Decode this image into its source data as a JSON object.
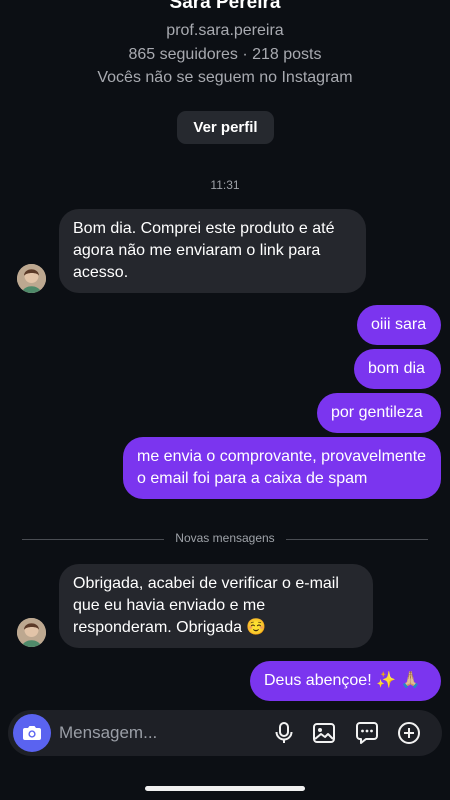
{
  "profile": {
    "name": "Sara Pereira",
    "handle": "prof.sara.pereira",
    "stats": "865 seguidores · 218 posts",
    "follow_note": "Vocês não se seguem no Instagram",
    "view_profile_label": "Ver perfil"
  },
  "chat": {
    "timestamp": "11:31",
    "messages": [
      {
        "from": "them",
        "text": "Bom dia. Comprei este produto e até agora não me enviaram o link para acesso."
      },
      {
        "from": "me",
        "text": "oiii sara"
      },
      {
        "from": "me",
        "text": "bom dia"
      },
      {
        "from": "me",
        "text": "por gentileza"
      },
      {
        "from": "me",
        "text": "me envia o comprovante, provavelmente o email foi para a caixa de spam"
      },
      {
        "from": "them",
        "text": "Obrigada, acabei de verificar o e-mail que eu havia enviado e me responderam. Obrigada ☺️"
      },
      {
        "from": "me",
        "text": "Deus abençoe! ✨ 🙏🏼"
      }
    ],
    "divider_label": "Novas mensagens"
  },
  "composer": {
    "placeholder": "Mensagem...",
    "icons": [
      "camera-icon",
      "microphone-icon",
      "image-icon",
      "sticker-icon",
      "plus-icon"
    ]
  },
  "colors": {
    "background": "#0c0f14",
    "incoming_bubble": "#25272d",
    "outgoing_bubble": "#7b35ef",
    "camera_button": "#5a63f0"
  }
}
